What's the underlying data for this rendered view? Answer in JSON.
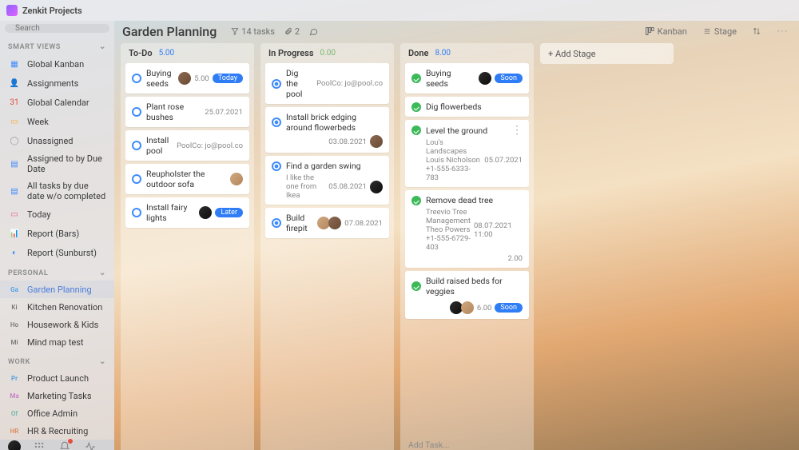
{
  "app": {
    "name": "Zenkit Projects"
  },
  "search": {
    "placeholder": "Search"
  },
  "sidebar": {
    "sections": {
      "smartViews": {
        "label": "SMART VIEWS"
      },
      "personal": {
        "label": "PERSONAL"
      },
      "work": {
        "label": "WORK"
      }
    },
    "smartViews": [
      {
        "label": "Global Kanban",
        "iconColor": "#3d8bfd"
      },
      {
        "label": "Assignments",
        "iconColor": "#3d8bfd"
      },
      {
        "label": "Global Calendar",
        "iconColor": "#e74c3c"
      },
      {
        "label": "Week",
        "iconColor": "#f5a623"
      },
      {
        "label": "Unassigned",
        "iconColor": "#9a9a9a"
      },
      {
        "label": "Assigned to by Due Date",
        "iconColor": "#3d8bfd"
      },
      {
        "label": "All tasks by due date w/o completed",
        "iconColor": "#3d8bfd"
      },
      {
        "label": "Today",
        "iconColor": "#e95d7a"
      },
      {
        "label": "Report (Bars)",
        "iconColor": "#3d8bfd"
      },
      {
        "label": "Report (Sunburst)",
        "iconColor": "#3d8bfd"
      }
    ],
    "personal": [
      {
        "label": "Garden Planning",
        "abbrev": "Ga",
        "color": "#4a9de0",
        "active": true
      },
      {
        "label": "Kitchen Renovation",
        "abbrev": "Ki",
        "color": "#7a7a7a"
      },
      {
        "label": "Housework & Kids",
        "abbrev": "Ho",
        "color": "#7a7a7a"
      },
      {
        "label": "Mind map test",
        "abbrev": "Mi",
        "color": "#7a7a7a"
      }
    ],
    "work": [
      {
        "label": "Product Launch",
        "abbrev": "Pr",
        "color": "#4a9de0"
      },
      {
        "label": "Marketing Tasks",
        "abbrev": "Ma",
        "color": "#c57bc5"
      },
      {
        "label": "Office Admin",
        "abbrev": "Of",
        "color": "#6eb8b0"
      },
      {
        "label": "HR & Recruiting",
        "abbrev": "HR",
        "color": "#d98a5e"
      }
    ]
  },
  "board": {
    "title": "Garden Planning",
    "taskCount": "14 tasks",
    "attachments": "2",
    "viewLabel": "Kanban",
    "stageLabel": "Stage"
  },
  "columns": [
    {
      "title": "To-Do",
      "count": "5.00",
      "countColor": "#2f7df6",
      "status": "open",
      "cards": [
        {
          "title": "Buying seeds",
          "avatar": "brown",
          "meta": "5.00",
          "pill": "Today"
        },
        {
          "title": "Plant rose bushes",
          "meta": "25.07.2021"
        },
        {
          "title": "Install pool",
          "meta": "PoolCo: jo@pool.co"
        },
        {
          "title": "Reupholster the outdoor sofa",
          "avatar": "sand"
        },
        {
          "title": "Install fairy lights",
          "avatar": "dark",
          "pill": "Later"
        }
      ]
    },
    {
      "title": "In Progress",
      "count": "0.00",
      "countColor": "#7bb76f",
      "status": "progress",
      "cards": [
        {
          "title": "Dig the pool",
          "meta": "PoolCo: jo@pool.co"
        },
        {
          "title": "Install brick edging around flowerbeds",
          "subMeta": "03.08.2021",
          "subAvatar": "brown"
        },
        {
          "title": "Find a garden swing",
          "subNote": "I like the one from Ikea",
          "subMeta": "05.08.2021",
          "subAvatar": "dark"
        },
        {
          "title": "Build firepit",
          "meta": "07.08.2021",
          "avatarsMulti": [
            "sand",
            "brown"
          ]
        }
      ]
    },
    {
      "title": "Done",
      "count": "8.00",
      "countColor": "#2f7df6",
      "status": "done",
      "addTaskFooter": "Add Task...",
      "cards": [
        {
          "title": "Buying seeds",
          "avatar": "dark",
          "pill": "Soon"
        },
        {
          "title": "Dig flowerbeds"
        },
        {
          "title": "Level the ground",
          "subNote": "Lou's Landscapes Louis Nicholson +1-555-6333-783",
          "subMeta": "05.07.2021",
          "showMore": true
        },
        {
          "title": "Remove dead tree",
          "subNote": "Treevio Tree Management Theo Powers +1-555-6729-403",
          "subMeta": "08.07.2021 11:00",
          "subMeta2": "2.00"
        },
        {
          "title": "Build raised beds for veggies",
          "subAvatars": [
            "dark",
            "sand"
          ],
          "subValue": "6.00",
          "subPill": "Soon"
        }
      ]
    }
  ],
  "addStage": {
    "label": "+ Add Stage"
  }
}
